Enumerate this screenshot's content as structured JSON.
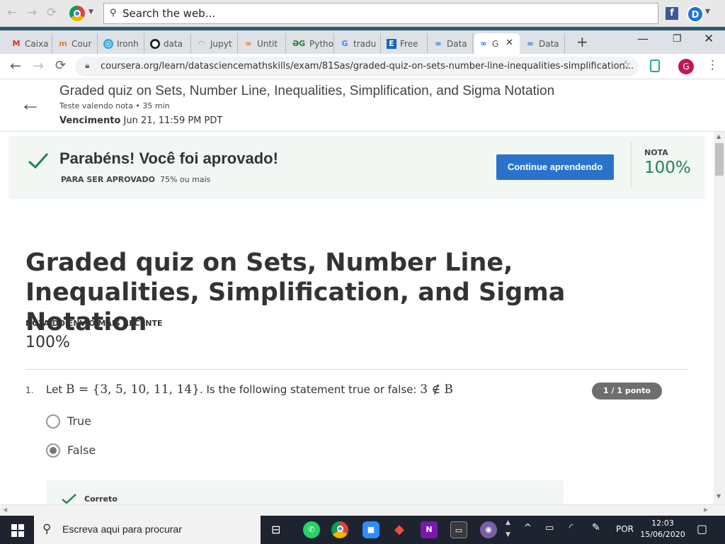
{
  "topbar": {
    "search_placeholder": "Search the web..."
  },
  "tabs": [
    {
      "label": "Caixa",
      "icon": "gmail-icon"
    },
    {
      "label": "Cour",
      "icon": "coursera-icon"
    },
    {
      "label": "Ironh",
      "icon": "ironhack-icon"
    },
    {
      "label": "data",
      "icon": "github-icon"
    },
    {
      "label": "Jupyt",
      "icon": "jupyter-icon"
    },
    {
      "label": "Untit",
      "icon": "colab-icon"
    },
    {
      "label": "Pytho",
      "icon": "dg-icon"
    },
    {
      "label": "tradu",
      "icon": "google-icon"
    },
    {
      "label": "Free",
      "icon": "e-icon"
    },
    {
      "label": "Data",
      "icon": "colab-icon"
    },
    {
      "label": "G",
      "icon": "colab-icon"
    },
    {
      "label": "Data",
      "icon": "colab-icon"
    }
  ],
  "address": {
    "url": "coursera.org/learn/datasciencemathskills/exam/81Sas/graded-quiz-on-sets-number-line-inequalities-simplification..."
  },
  "profile_initial": "G",
  "header": {
    "title": "Graded quiz on Sets, Number Line, Inequalities, Simplification, and Sigma Notation",
    "subtitle": "Teste valendo nota • 35 min",
    "due_label": "Vencimento",
    "due_value": "Jun 21, 11:59 PM PDT"
  },
  "banner": {
    "message": "Parabéns! Você foi aprovado!",
    "pass_label": "PARA SER APROVADO",
    "pass_value": "75% ou mais",
    "button": "Continue aprendendo",
    "grade_label": "NOTA",
    "grade_value": "100%"
  },
  "quiz": {
    "title": "Graded quiz on Sets, Number Line, Inequalities, Simplification, and Sigma Notation",
    "recent_label": "NOTA DO ENVIO MAIS RECENTE",
    "recent_value": "100%",
    "q1": {
      "number": "1.",
      "prefix": "Let ",
      "set_expr": "B = {3, 5, 10, 11, 14}",
      "middle": ". Is the following statement true or false: ",
      "statement": "3 ∉ B",
      "points": "1 / 1 ponto",
      "options": [
        "True",
        "False"
      ],
      "selected": "False",
      "feedback": "Correto"
    }
  },
  "taskbar": {
    "search_placeholder": "Escreva aqui para procurar",
    "lang": "POR",
    "time": "12:03",
    "date": "15/06/2020"
  }
}
